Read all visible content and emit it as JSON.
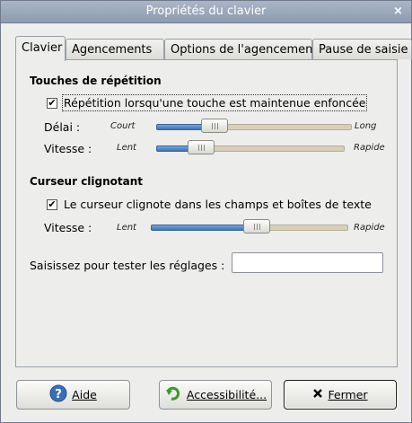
{
  "window": {
    "title": "Propriétés du clavier",
    "close_glyph": "×"
  },
  "tabs": [
    {
      "label": "Clavier",
      "active": true
    },
    {
      "label": "Agencements",
      "active": false
    },
    {
      "label": "Options de l'agencement",
      "active": false
    },
    {
      "label": "Pause de saisie",
      "active": false
    }
  ],
  "repeat": {
    "heading": "Touches de répétition",
    "checkbox_label": "Répétition lorsqu'une touche est maintenue enfoncée",
    "checked": true,
    "delay": {
      "label": "Délai :",
      "min_label": "Court",
      "max_label": "Long",
      "value_fraction": 0.31
    },
    "speed": {
      "label": "Vitesse :",
      "min_label": "Lent",
      "max_label": "Rapide",
      "value_fraction": 0.2
    }
  },
  "cursor": {
    "heading": "Curseur clignotant",
    "checkbox_label": "Le curseur clignote dans les champs et boîtes de texte",
    "checked": true,
    "speed": {
      "label": "Vitesse :",
      "min_label": "Lent",
      "max_label": "Rapide",
      "value_fraction": 0.53
    }
  },
  "test": {
    "label": "Saisissez pour tester les réglages :",
    "value": "",
    "placeholder": ""
  },
  "buttons": {
    "help": {
      "label": "Aide",
      "icon": "help-icon"
    },
    "accessibility": {
      "label": "Accessibilité...",
      "icon": "refresh-arrow-icon"
    },
    "close": {
      "label": "Fermer",
      "icon": "close-x-icon"
    }
  },
  "check_glyph": "✔"
}
